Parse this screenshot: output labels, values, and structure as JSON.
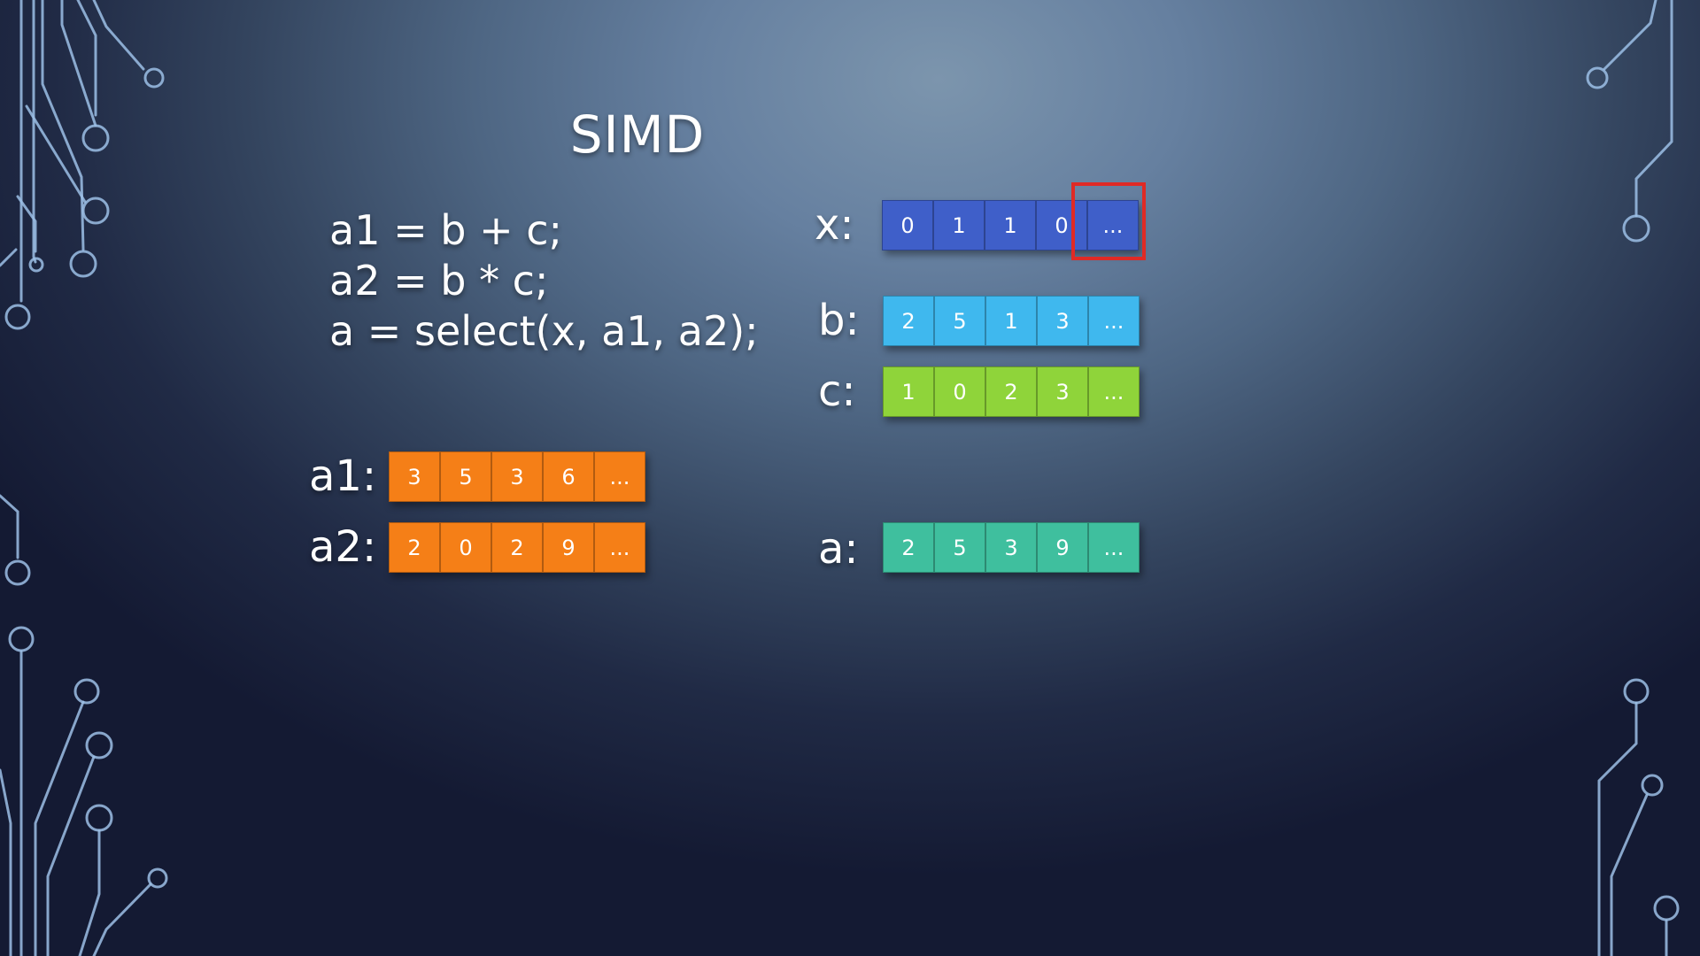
{
  "slide": {
    "title": "SIMD",
    "code_lines": [
      "a1 = b + c;",
      "a2 = b * c;",
      "a = select(x, a1, a2);"
    ]
  },
  "vectors": {
    "x": {
      "label": "x:",
      "values": [
        "0",
        "1",
        "1",
        "0",
        "..."
      ],
      "color": "#3f5fc9"
    },
    "b": {
      "label": "b:",
      "values": [
        "2",
        "5",
        "1",
        "3",
        "..."
      ],
      "color": "#3fb8ee"
    },
    "c": {
      "label": "c:",
      "values": [
        "1",
        "0",
        "2",
        "3",
        "..."
      ],
      "color": "#8fd43a"
    },
    "a1": {
      "label": "a1:",
      "values": [
        "3",
        "5",
        "3",
        "6",
        "..."
      ],
      "color": "#f57f17"
    },
    "a2": {
      "label": "a2:",
      "values": [
        "2",
        "0",
        "2",
        "9",
        "..."
      ],
      "color": "#f57f17"
    },
    "a": {
      "label": "a:",
      "values": [
        "2",
        "5",
        "3",
        "9",
        "..."
      ],
      "color": "#3fbf9e"
    }
  },
  "highlight": {
    "color": "#e02a25"
  }
}
